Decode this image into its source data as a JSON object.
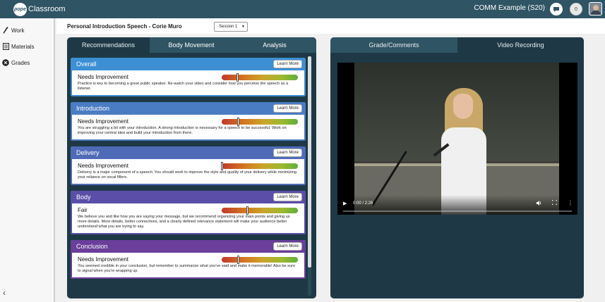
{
  "app": {
    "logo_mark": "pope",
    "logo_text": "Classroom",
    "course_title": "COMM Example (S20)",
    "notification_count": "0"
  },
  "sidebar": {
    "items": [
      {
        "label": "Work",
        "icon": "pencil-icon"
      },
      {
        "label": "Materials",
        "icon": "materials-icon"
      },
      {
        "label": "Grades",
        "icon": "grades-icon"
      }
    ]
  },
  "header": {
    "speech_title": "Personal Introduction Speech - Corie Muro",
    "session_value": "Session 1"
  },
  "left_tabs": [
    "Recommendations",
    "Body Movement",
    "Analysis"
  ],
  "learn_more_label": "Learn More",
  "cards": [
    {
      "title": "Overall",
      "color": "#3c8fd3",
      "rating": "Needs Improvement",
      "meter_position": 0.2,
      "text": "Practice is key to becoming a great public speaker. Re-watch your video and consider how you perceive the speech as a listener."
    },
    {
      "title": "Introduction",
      "color": "#4a7cc4",
      "rating": "Needs Improvement",
      "meter_position": 0.21,
      "text": "You are struggling a bit with your introduction. A strong introduction is necessary for a speech to be successful. Work on improving your central idea and build your introduction from there."
    },
    {
      "title": "Delivery",
      "color": "#4f6bb8",
      "rating": "Needs Improvement",
      "meter_position": 0.0,
      "text": "Delivery is a major component of a speech. You should work to improve the style and quality of your delivery while minimizing your reliance on vocal fillers."
    },
    {
      "title": "Body",
      "color": "#5a4ea8",
      "rating": "Fair",
      "meter_position": 0.33,
      "text": "We believe you and like how you are saying your message, but we recommend organizing your main points and giving us more details. More details, better connectives, and a clearly defined relevance statement will make your audience better understand what you are trying to say."
    },
    {
      "title": "Conclusion",
      "color": "#6a3e9a",
      "rating": "Needs Improvement",
      "meter_position": 0.21,
      "text": "You seemed credible in your conclusion, but remember to summarize what you've said and make it memorable! Also be sure to signal when you're wrapping up."
    }
  ],
  "right_tabs": [
    "Grade/Comments",
    "Video Recording"
  ],
  "video": {
    "time": "0:00 / 2:26"
  }
}
